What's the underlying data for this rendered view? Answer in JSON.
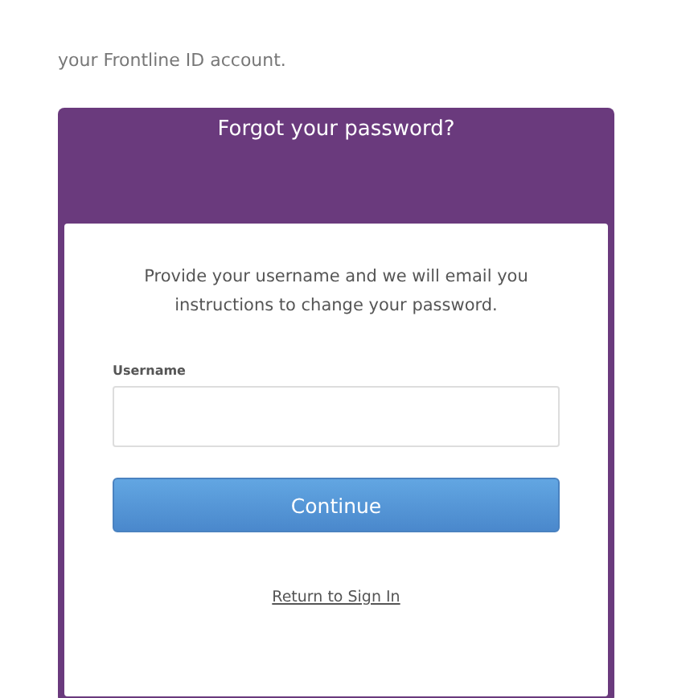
{
  "intro_text": "your Frontline ID account.",
  "dialog": {
    "title": "Forgot your password?",
    "instructions": "Provide your username and we will email you instructions to change your password.",
    "username_field": {
      "label": "Username"
    },
    "continue_button": "Continue",
    "return_link": "Return to Sign In"
  }
}
